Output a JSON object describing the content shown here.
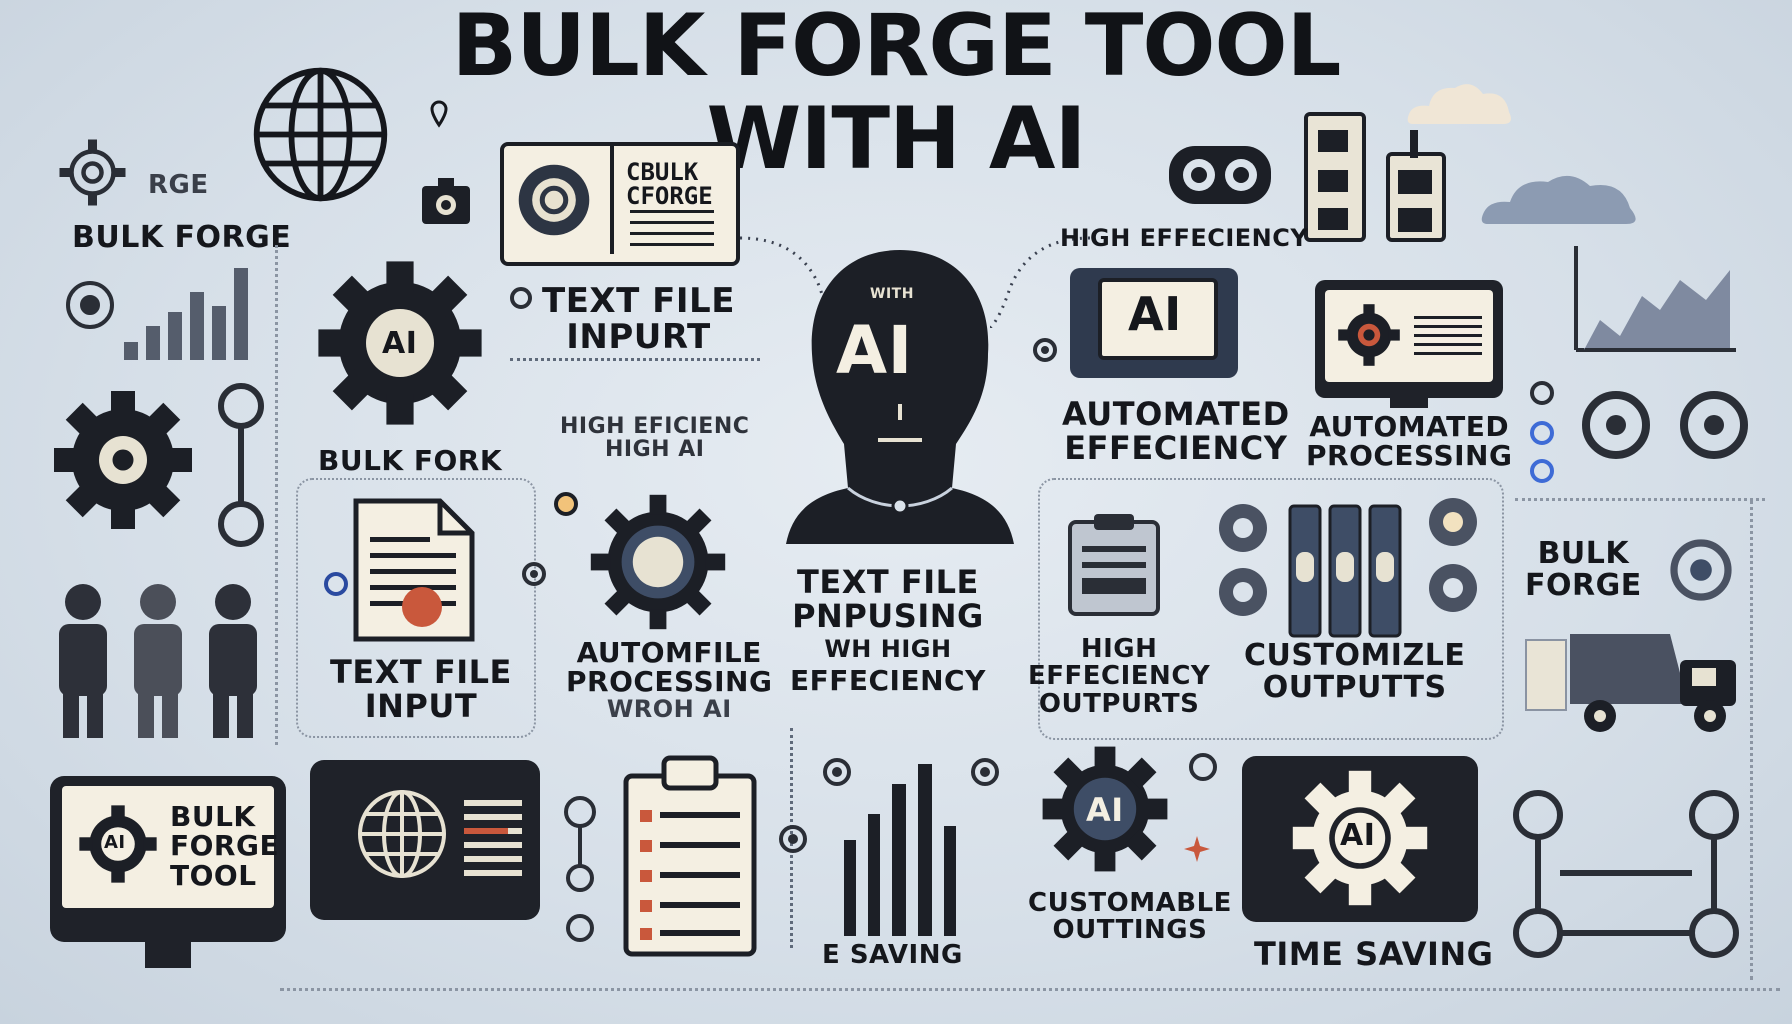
{
  "title": {
    "line1": "BULK FORGE TOOL",
    "line2": "WITH AI"
  },
  "labels": {
    "rge": "RGE",
    "bulk_forge_top": "BULK FORGE",
    "doc_card": {
      "line1": "CBULK",
      "line2": "CFORGE"
    },
    "high_efficiency_top": "HIGH EFFECIENCY",
    "text_file_input_top": {
      "line1": "TEXT FILE",
      "line2": "INPURT"
    },
    "high_eficienc": {
      "line1": "HIGH EFICIENC",
      "line2": "HIGH AI"
    },
    "bulk_fork": "BULK FORK",
    "head_with": "WITH",
    "head_ai": "AI",
    "monitor_ai": "AI",
    "automated_effeciency": {
      "line1": "AUTOMATED",
      "line2": "EFFECIENCY"
    },
    "automated_processing": {
      "line1": "AUTOMATED",
      "line2": "PROCESSING"
    },
    "gear_ai_left": "AI",
    "text_file_input_left": {
      "line1": "TEXT FILE",
      "line2": "INPUT"
    },
    "automfile": {
      "line1": "AUTOMFILE",
      "line2": "PROCESSING",
      "line3": "WROH AI"
    },
    "text_file_pnpusing": {
      "line1": "TEXT FILE",
      "line2": "PNPUSING",
      "line3": "WH HIGH",
      "line4": "EFFECIENCY"
    },
    "high_effeciency_outputs": {
      "line1": "HIGH",
      "line2": "EFFECIENCY",
      "line3": "OUTPURTS"
    },
    "customizle_outputs": {
      "line1": "CUSTOMIZLE",
      "line2": "OUTPUTTS"
    },
    "bulk_forge_right": {
      "line1": "BULK",
      "line2": "FORGE"
    },
    "monitor_bulk_forge_tool": {
      "line1": "BULK",
      "line2": "FORGE",
      "line3": "TOOL",
      "badge": "AI"
    },
    "e_saving": "E SAVING",
    "gear_ai_bottom": "AI",
    "customable_outtings": {
      "line1": "CUSTOMABLE",
      "line2": "OUTTINGS"
    },
    "time_saving_gear": "AI",
    "time_saving": "TIME SAVING"
  },
  "colors": {
    "background": "#dbe3eb",
    "ink": "#15171c",
    "accent": "#c9583c",
    "navy": "#3e4d66",
    "cream": "#f4efe2"
  }
}
